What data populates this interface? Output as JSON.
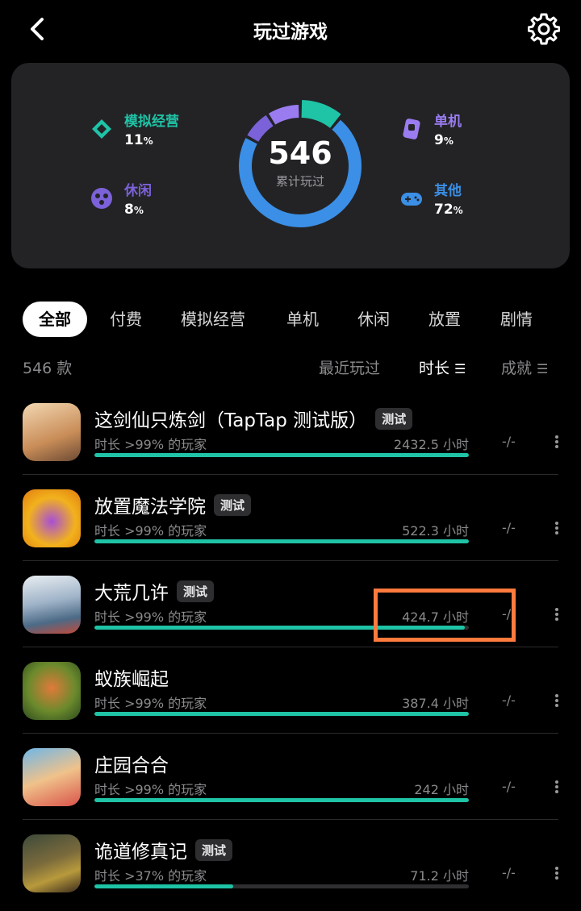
{
  "header": {
    "title": "玩过游戏"
  },
  "summary": {
    "total": "546",
    "total_label": "累计玩过",
    "categories": [
      {
        "label": "模拟经营",
        "pct": "11",
        "unit": "%",
        "color": "#1fc3a6",
        "icon": "sim-icon"
      },
      {
        "label": "休闲",
        "pct": "8",
        "unit": "%",
        "color": "#7b62d8",
        "icon": "casual-icon"
      },
      {
        "label": "单机",
        "pct": "9",
        "unit": "%",
        "color": "#9a7cf0",
        "icon": "single-icon"
      },
      {
        "label": "其他",
        "pct": "72",
        "unit": "%",
        "color": "#3b8fe6",
        "icon": "other-icon"
      }
    ]
  },
  "tabs": [
    "全部",
    "付费",
    "模拟经营",
    "单机",
    "休闲",
    "放置",
    "剧情"
  ],
  "sort": {
    "count": "546 款",
    "recent": "最近玩过",
    "duration": "时长",
    "achievement": "成就"
  },
  "games": [
    {
      "name": "这剑仙只炼剑（TapTap 测试版）",
      "badge": "测试",
      "rank": "时长 >99% 的玩家",
      "hours": "2432.5 小时",
      "progress": 1.0,
      "achv": "-/-"
    },
    {
      "name": "放置魔法学院",
      "badge": "测试",
      "rank": "时长 >99% 的玩家",
      "hours": "522.3 小时",
      "progress": 1.0,
      "achv": "-/-"
    },
    {
      "name": "大荒几许",
      "badge": "测试",
      "rank": "时长 >99% 的玩家",
      "hours": "424.7 小时",
      "progress": 0.99,
      "achv": "-/-"
    },
    {
      "name": "蚁族崛起",
      "badge": "",
      "rank": "时长 >99% 的玩家",
      "hours": "387.4 小时",
      "progress": 1.0,
      "achv": "-/-"
    },
    {
      "name": "庄园合合",
      "badge": "",
      "rank": "时长 >99% 的玩家",
      "hours": "242 小时",
      "progress": 1.0,
      "achv": "-/-"
    },
    {
      "name": "诡道修真记",
      "badge": "测试",
      "rank": "时长 >37% 的玩家",
      "hours": "71.2 小时",
      "progress": 0.37,
      "achv": "-/-"
    }
  ]
}
